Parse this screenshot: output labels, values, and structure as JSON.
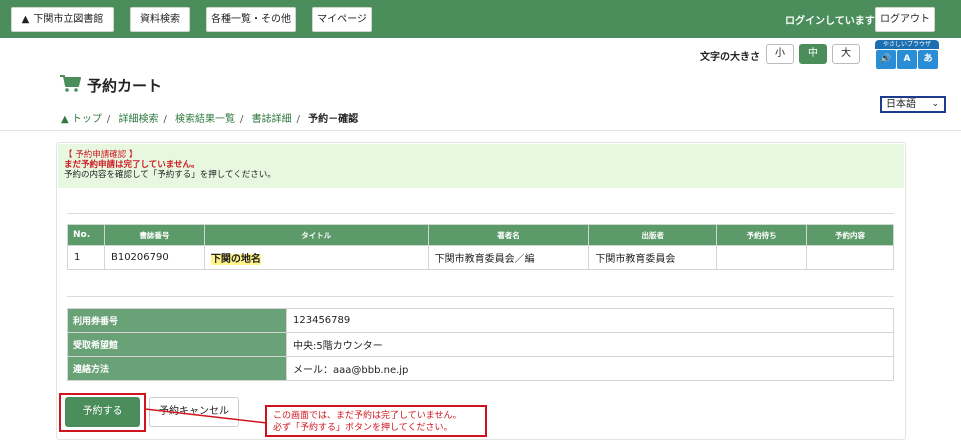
{
  "header": {
    "nav": [
      {
        "label": "下関市立図書館"
      },
      {
        "label": "資料検索"
      },
      {
        "label": "各種一覧・その他"
      },
      {
        "label": "マイページ"
      }
    ],
    "login_status": "ログインしています",
    "logout_label": "ログアウト"
  },
  "font_size": {
    "label": "文字の大きさ",
    "options": [
      "小",
      "中",
      "大"
    ],
    "selected": "中"
  },
  "easy_browser": {
    "label": "やさしいブラウザ",
    "tiles": [
      "🔊",
      "A",
      "あ"
    ]
  },
  "page": {
    "title": "予約カート",
    "language": "日本語"
  },
  "breadcrumb": {
    "items": [
      "トップ",
      "詳細検索",
      "検索結果一覧",
      "書誌詳細"
    ],
    "current": "予約－確認"
  },
  "notice": {
    "line1": "【 予約申請確認 】",
    "line2": "まだ予約申請は完了していません。",
    "line3": "予約の内容を確認して「予約する」を押してください。"
  },
  "results_table": {
    "headers": [
      "No.",
      "書誌番号",
      "タイトル",
      "著者名",
      "出版者",
      "予約待ち",
      "予約内容"
    ],
    "rows": [
      [
        "1",
        "B10206790",
        "下関の地名",
        "下関市教育委員会／編",
        "下関市教育委員会",
        "",
        ""
      ]
    ]
  },
  "info_table": {
    "rows": [
      {
        "label": "利用券番号",
        "value": "123456789"
      },
      {
        "label": "受取希望館",
        "value": "中央:5階カウンター"
      },
      {
        "label": "連絡方法",
        "value": "メール：aaa@bbb.ne.jp"
      }
    ]
  },
  "actions": {
    "reserve_label": "予約する",
    "cancel_label": "予約キャンセル"
  },
  "callout": {
    "line1": "この画面では、まだ予約は完了していません。",
    "line2": "必ず「予約する」ボタンを押してください。"
  },
  "colors": {
    "brand_green": "#4b8e5c",
    "header_green": "#5c9a6a",
    "alert_red": "#d0141e",
    "notice_bg": "#e7f7e0"
  }
}
